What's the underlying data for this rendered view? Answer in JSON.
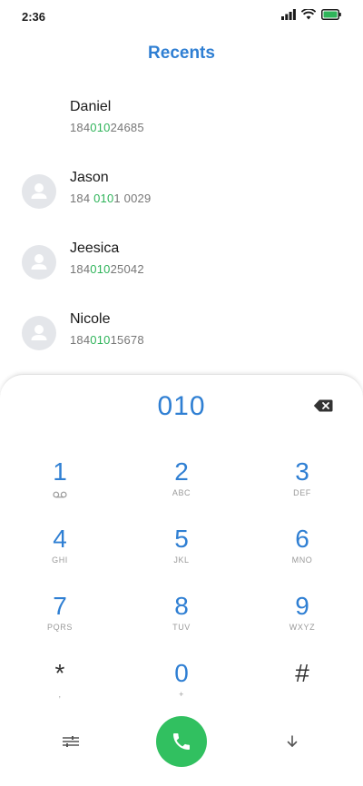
{
  "status_bar": {
    "time": "2:36",
    "icons": [
      "signal-icon",
      "wifi-icon",
      "battery-icon"
    ],
    "battery_color": "#2fb45a"
  },
  "header": {
    "title": "Recents"
  },
  "contacts": [
    {
      "name": "Daniel",
      "number_pre": "184",
      "number_match": "010",
      "number_post": "24685",
      "has_avatar": false
    },
    {
      "name": "Jason",
      "number_pre": "184 ",
      "number_match": "010",
      "number_post": "1 0029",
      "has_avatar": true
    },
    {
      "name": "Jeesica",
      "number_pre": "184",
      "number_match": "010",
      "number_post": "25042",
      "has_avatar": true
    },
    {
      "name": "Nicole",
      "number_pre": "184",
      "number_match": "010",
      "number_post": "15678",
      "has_avatar": true
    }
  ],
  "dialpad": {
    "entered": "010",
    "keys": [
      {
        "digit": "1",
        "letters": "",
        "sub_icon": "voicemail-icon"
      },
      {
        "digit": "2",
        "letters": "ABC"
      },
      {
        "digit": "3",
        "letters": "DEF"
      },
      {
        "digit": "4",
        "letters": "GHI"
      },
      {
        "digit": "5",
        "letters": "JKL"
      },
      {
        "digit": "6",
        "letters": "MNO"
      },
      {
        "digit": "7",
        "letters": "PQRS"
      },
      {
        "digit": "8",
        "letters": "TUV"
      },
      {
        "digit": "9",
        "letters": "WXYZ"
      },
      {
        "digit": "*",
        "letters": ","
      },
      {
        "digit": "0",
        "letters": "+"
      },
      {
        "digit": "#",
        "letters": ""
      }
    ],
    "bottom_icons": [
      "settings-sliders-icon",
      "phone-icon",
      "arrow-down-icon"
    ]
  },
  "colors": {
    "accent": "#2f7fd3",
    "match_highlight": "#2fb45a",
    "call_button": "#31c060"
  }
}
